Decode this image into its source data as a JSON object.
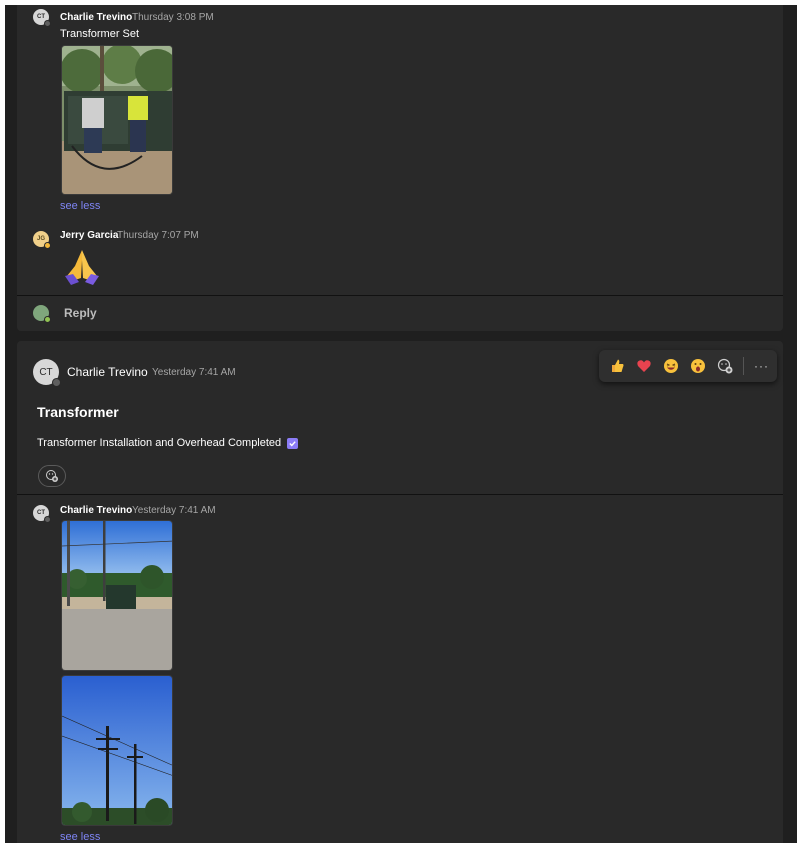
{
  "thread1": {
    "message1": {
      "author": "Charlie Trevino",
      "time": "Thursday 3:08 PM",
      "text": "Transformer Set",
      "see_less": "see less",
      "avatar_initials": "CT"
    },
    "message2": {
      "author": "Jerry Garcia",
      "time": "Thursday 7:07 PM",
      "avatar_initials": "JG",
      "emoji": "folded-hands"
    },
    "reply_label": "Reply"
  },
  "thread2": {
    "post": {
      "author": "Charlie Trevino",
      "time": "Yesterday 7:41 AM",
      "avatar_initials": "CT",
      "title": "Transformer",
      "body": "Transformer Installation and Overhead Completed"
    },
    "reaction_bar": {
      "items": [
        "like",
        "heart",
        "laugh",
        "surprised",
        "add-reaction"
      ],
      "more": "···"
    },
    "reply": {
      "author": "Charlie Trevino",
      "time": "Yesterday 7:41 AM",
      "avatar_initials": "CT",
      "see_less": "see less"
    }
  },
  "colors": {
    "background": "#1f1f1f",
    "card": "#292929",
    "link": "#7f85f5",
    "muted": "#a6a6a6",
    "check": "#8b7cf6"
  }
}
